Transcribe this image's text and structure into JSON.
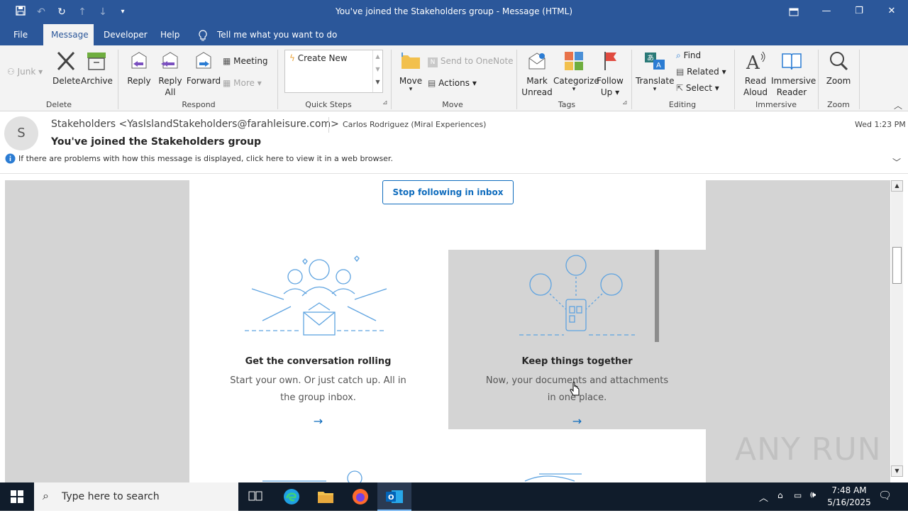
{
  "window": {
    "title": "You've joined the Stakeholders group  -  Message (HTML)"
  },
  "tabs": [
    {
      "label": "File"
    },
    {
      "label": "Message"
    },
    {
      "label": "Developer"
    },
    {
      "label": "Help"
    }
  ],
  "tell_me": "Tell me what you want to do",
  "ribbon": {
    "junk": "Junk",
    "delete": "Delete",
    "archive": "Archive",
    "group_delete": "Delete",
    "reply": "Reply",
    "reply_all_1": "Reply",
    "reply_all_2": "All",
    "forward": "Forward",
    "meeting": "Meeting",
    "more": "More",
    "group_respond": "Respond",
    "create_new": "Create New",
    "group_quick_steps": "Quick Steps",
    "move": "Move",
    "send_to_onenote": "Send to OneNote",
    "actions": "Actions",
    "group_move": "Move",
    "mark_unread_1": "Mark",
    "mark_unread_2": "Unread",
    "categorize": "Categorize",
    "follow_up_1": "Follow",
    "follow_up_2": "Up",
    "group_tags": "Tags",
    "translate": "Translate",
    "find": "Find",
    "related": "Related",
    "select": "Select",
    "group_editing": "Editing",
    "read_aloud_1": "Read",
    "read_aloud_2": "Aloud",
    "immersive_reader_1": "Immersive",
    "immersive_reader_2": "Reader",
    "group_immersive": "Immersive",
    "zoom": "Zoom",
    "group_zoom": "Zoom"
  },
  "message": {
    "avatar_initial": "S",
    "from": "Stakeholders <YasIslandStakeholders@farahleisure.com>",
    "sender_name": "Carlos Rodriguez (Miral Experiences)",
    "subject": "You've joined the Stakeholders group",
    "info_bar": "If there are problems with how this message is displayed, click here to view it in a web browser.",
    "time": "Wed 1:23 PM"
  },
  "body": {
    "stop_following": "Stop following in inbox",
    "card1_title": "Get the conversation rolling",
    "card1_desc": "Start your own. Or just catch up. All in the group inbox.",
    "card2_title": "Keep things together",
    "card2_desc": "Now, your documents and attachments in one place.",
    "arrow": "→"
  },
  "watermark": "ANY RUN",
  "taskbar": {
    "search_placeholder": "Type here to search",
    "time": "7:48 AM",
    "date": "5/16/2025"
  },
  "colors": {
    "titlebar": "#2b579a",
    "accent": "#0f6cbd",
    "taskbar": "#101c2b"
  }
}
